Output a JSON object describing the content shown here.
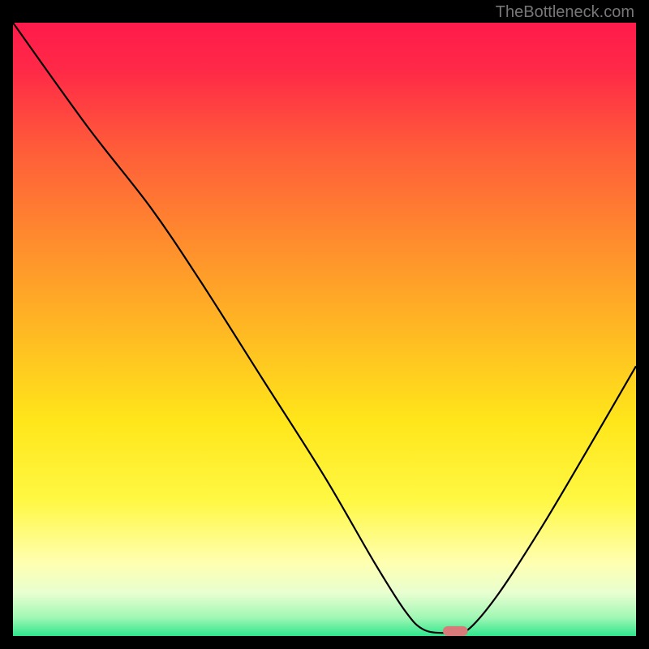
{
  "watermark": "TheBottleneck.com",
  "chart_data": {
    "type": "line",
    "title": "",
    "xlabel": "",
    "ylabel": "",
    "xlim": [
      0,
      100
    ],
    "ylim": [
      0,
      100
    ],
    "background_gradient": {
      "stops": [
        {
          "offset": 0.0,
          "color": "#ff1a4b"
        },
        {
          "offset": 0.08,
          "color": "#ff2a47"
        },
        {
          "offset": 0.2,
          "color": "#ff5a3a"
        },
        {
          "offset": 0.35,
          "color": "#ff8a2e"
        },
        {
          "offset": 0.5,
          "color": "#ffb823"
        },
        {
          "offset": 0.65,
          "color": "#ffe61a"
        },
        {
          "offset": 0.78,
          "color": "#fff844"
        },
        {
          "offset": 0.88,
          "color": "#ffffb0"
        },
        {
          "offset": 0.93,
          "color": "#e8ffd0"
        },
        {
          "offset": 0.97,
          "color": "#a0f7b5"
        },
        {
          "offset": 1.0,
          "color": "#2fe58c"
        }
      ]
    },
    "series": [
      {
        "name": "curve",
        "stroke": "#000000",
        "stroke_width": 2.2,
        "points": [
          {
            "x": 0,
            "y": 100
          },
          {
            "x": 12,
            "y": 83
          },
          {
            "x": 22,
            "y": 70
          },
          {
            "x": 30,
            "y": 58
          },
          {
            "x": 40,
            "y": 42
          },
          {
            "x": 50,
            "y": 26
          },
          {
            "x": 58,
            "y": 12
          },
          {
            "x": 63,
            "y": 4
          },
          {
            "x": 66,
            "y": 1
          },
          {
            "x": 70,
            "y": 0.5
          },
          {
            "x": 73,
            "y": 1
          },
          {
            "x": 78,
            "y": 7
          },
          {
            "x": 85,
            "y": 18
          },
          {
            "x": 92,
            "y": 30
          },
          {
            "x": 100,
            "y": 44
          }
        ]
      }
    ],
    "marker": {
      "name": "highlight",
      "x": 71,
      "y": 0.8,
      "width": 4,
      "height": 1.6,
      "color": "#d97a7a"
    }
  }
}
